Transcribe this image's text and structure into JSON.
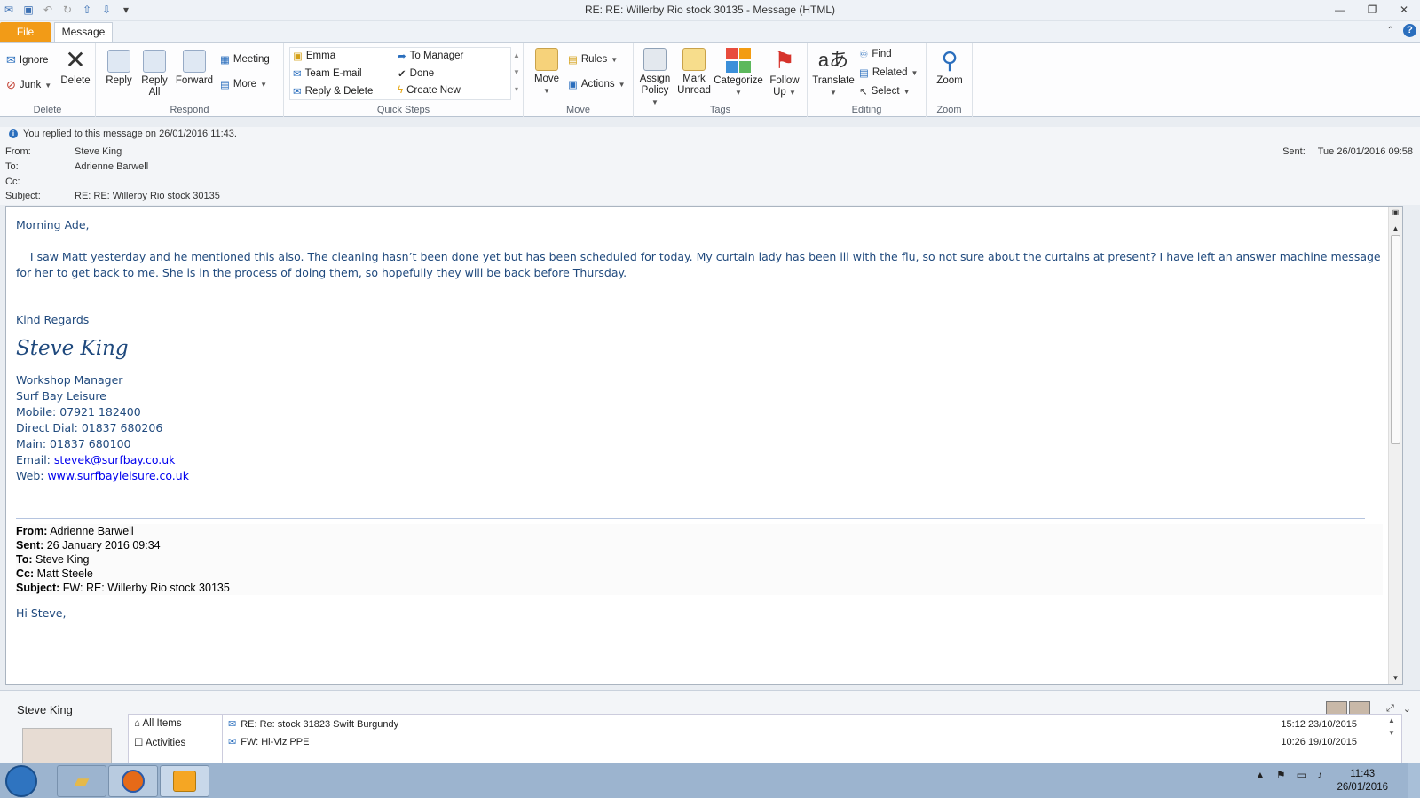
{
  "window": {
    "title": "RE: RE: Willerby Rio stock 30135  -  Message (HTML)"
  },
  "tabs": {
    "file": "File",
    "message": "Message"
  },
  "ribbon": {
    "delete_group": {
      "label": "Delete",
      "ignore": "Ignore",
      "junk": "Junk",
      "delete": "Delete"
    },
    "respond_group": {
      "label": "Respond",
      "reply": "Reply",
      "reply_all_1": "Reply",
      "reply_all_2": "All",
      "forward": "Forward",
      "meeting": "Meeting",
      "more": "More"
    },
    "quick_steps": {
      "label": "Quick Steps",
      "items": [
        "Emma",
        "To Manager",
        "Team E-mail",
        "Done",
        "Reply & Delete",
        "Create New"
      ]
    },
    "move_group": {
      "label": "Move",
      "move": "Move",
      "rules": "Rules",
      "actions": "Actions"
    },
    "tags_group": {
      "label": "Tags",
      "assign_1": "Assign",
      "assign_2": "Policy",
      "mark_1": "Mark",
      "mark_2": "Unread",
      "categorize": "Categorize",
      "follow_1": "Follow",
      "follow_2": "Up"
    },
    "editing_group": {
      "label": "Editing",
      "translate": "Translate",
      "find": "Find",
      "related": "Related",
      "select": "Select"
    },
    "zoom_group": {
      "label": "Zoom",
      "zoom": "Zoom"
    }
  },
  "header": {
    "notice": "You replied to this message on 26/01/2016 11:43.",
    "from_label": "From:",
    "from": "Steve King",
    "to_label": "To:",
    "to": "Adrienne Barwell",
    "cc_label": "Cc:",
    "cc": "",
    "subject_label": "Subject:",
    "subject": "RE: RE: Willerby Rio stock 30135",
    "sent_label": "Sent:",
    "sent": "Tue 26/01/2016 09:58"
  },
  "body": {
    "greeting": "Morning Ade,",
    "paragraph": "    I saw Matt yesterday and he mentioned this also. The cleaning hasn’t been done yet but has been scheduled for today. My curtain lady has been ill with the flu, so not sure about the curtains at present? I have left an answer machine message for her to get back to me. She is in the process of doing them, so hopefully they will be back before Thursday.",
    "closing": "Kind Regards",
    "signature": "Steve King",
    "job_title": "Workshop Manager",
    "company": "Surf Bay Leisure",
    "mobile": "Mobile: 07921 182400",
    "direct": "Direct Dial: 01837 680206",
    "main": "Main: 01837 680100",
    "email_label": "Email: ",
    "email": "stevek@surfbay.co.uk",
    "web_label": "Web: ",
    "web": "www.surfbayleisure.co.uk"
  },
  "forwarded": {
    "from_label": "From:",
    "from": " Adrienne Barwell",
    "sent_label": "Sent:",
    "sent": " 26 January 2016 09:34",
    "to_label": "To:",
    "to": " Steve King",
    "cc_label": "Cc:",
    "cc": " Matt Steele",
    "subject_label": "Subject:",
    "subject": " FW: RE: Willerby Rio stock 30135",
    "greeting": "Hi Steve,"
  },
  "people_pane": {
    "name": "Steve King",
    "filter_all": "All Items",
    "filter_second": "Activities",
    "items": [
      {
        "subject": "RE: Re: stock 31823 Swift Burgundy",
        "date": "15:12  23/10/2015"
      },
      {
        "subject": "FW: Hi-Viz PPE",
        "date": "10:26  19/10/2015"
      }
    ]
  },
  "taskbar": {
    "time": "11:43",
    "date": "26/01/2016"
  }
}
